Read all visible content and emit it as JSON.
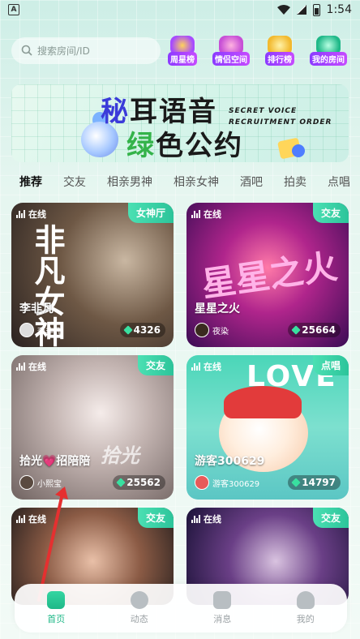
{
  "status_bar": {
    "time": "1:54",
    "app_badge": "A"
  },
  "search": {
    "placeholder": "搜索房间/ID"
  },
  "rank_icons": [
    {
      "label": "周星榜",
      "color": "#a74bff"
    },
    {
      "label": "情侣空间",
      "color": "#c74fd6"
    },
    {
      "label": "排行榜",
      "color": "#f2b92e"
    },
    {
      "label": "我的房间",
      "color": "#1fb888"
    }
  ],
  "banner": {
    "line1_accent": "秘",
    "line1_rest": "耳语音",
    "line2_accent": "绿",
    "line2_rest": "色公约",
    "english_line1": "SECRET VOICE",
    "english_line2": "RECRUITMENT ORDER"
  },
  "tabs": [
    "推荐",
    "交友",
    "相亲男神",
    "相亲女神",
    "酒吧",
    "拍卖",
    "点唱"
  ],
  "online_label": "在线",
  "cards": [
    {
      "tag": "女神厅",
      "title": "李非凡",
      "host": "李非凡",
      "count": "4326",
      "art": "非凡女神"
    },
    {
      "tag": "交友",
      "title": "星星之火",
      "host": "夜染",
      "count": "25664",
      "art": "星星之火"
    },
    {
      "tag": "交友",
      "title": "拾光💗招陪陪",
      "host": "小熙宝",
      "count": "25562",
      "art": "拾光"
    },
    {
      "tag": "点唱",
      "title": "游客300629",
      "host": "游客300629",
      "count": "14797",
      "art": "LOVE"
    },
    {
      "tag": "交友",
      "title": "",
      "host": "",
      "count": "",
      "art": ""
    },
    {
      "tag": "交友",
      "title": "",
      "host": "",
      "count": "",
      "art": ""
    }
  ],
  "nav": [
    {
      "label": "首页",
      "active": true
    },
    {
      "label": "动态",
      "active": false
    },
    {
      "label": "消息",
      "active": false
    },
    {
      "label": "我的",
      "active": false
    }
  ],
  "colors": {
    "accent": "#1fb888",
    "tag_bg": "#2cc49a"
  }
}
